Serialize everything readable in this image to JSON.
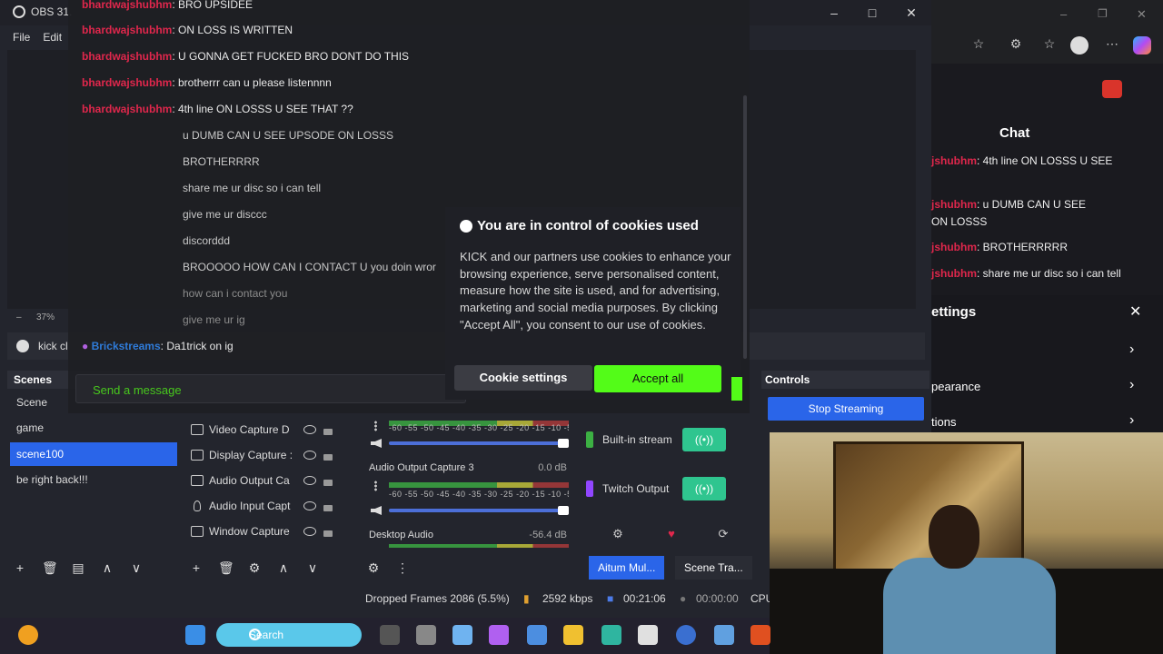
{
  "obs": {
    "title": "OBS 31.",
    "menu": [
      "File",
      "Edit"
    ],
    "zoom": "37%",
    "dock_tab": "kick cl",
    "scenes_header": "Scenes",
    "scenes": [
      "Scene",
      "game",
      "scene100",
      "be right back!!!"
    ],
    "active_scene_index": 2,
    "sources": [
      {
        "label": "Video Capture D",
        "icon": "camera-icon"
      },
      {
        "label": "Display Capture :",
        "icon": "monitor-icon"
      },
      {
        "label": "Audio Output Ca",
        "icon": "speaker-icon"
      },
      {
        "label": "Audio Input Capt",
        "icon": "microphone-icon"
      },
      {
        "label": "Window Capture",
        "icon": "window-icon"
      }
    ],
    "mixer": {
      "scale": "-60 -55 -50 -45 -40 -35 -30 -25 -20 -15 -10 -5 0",
      "channels": [
        {
          "label": "",
          "db": ""
        },
        {
          "label": "Audio Output Capture 3",
          "db": "0.0 dB"
        },
        {
          "label": "Desktop Audio",
          "db": "-56.4 dB"
        }
      ]
    },
    "outputs": [
      {
        "label": "Built-in stream",
        "marker_color": "#3cb043"
      },
      {
        "label": "Twitch Output",
        "marker_color": "#9146ff"
      }
    ],
    "controls_header": "Controls",
    "stop_streaming": "Stop Streaming",
    "bottom_tabs": [
      "Aitum Mul...",
      "Scene Tra..."
    ],
    "status": {
      "dropped_frames": "Dropped Frames 2086 (5.5%)",
      "bitrate": "2592 kbps",
      "stream_time": "00:21:06",
      "record_time": "00:00:00",
      "cpu": "CPU"
    }
  },
  "chat_overlay": {
    "messages": [
      {
        "user": "bhardwajshubhm",
        "text": ": BRO UPSIDEE",
        "style": "red"
      },
      {
        "user": "bhardwajshubhm",
        "text": ": ON LOSS IS WRITTEN",
        "style": "red"
      },
      {
        "user": "bhardwajshubhm",
        "text": ": U GONNA GET FUCKED BRO DONT DO THIS",
        "style": "red"
      },
      {
        "user": "bhardwajshubhm",
        "text": ": brotherrr can u please listennnn",
        "style": "red"
      },
      {
        "user": "bhardwajshubhm",
        "text": ": 4th line ON LOSSS U SEE THAT ??",
        "style": "red"
      },
      {
        "user": "",
        "text": "u DUMB CAN U SEE UPSODE ON LOSSS",
        "style": "dim"
      },
      {
        "user": "",
        "text": "BROTHERRRR",
        "style": "dim"
      },
      {
        "user": "",
        "text": "share me ur disc so i can tell",
        "style": "dim"
      },
      {
        "user": "",
        "text": "give me ur disccc",
        "style": "dim"
      },
      {
        "user": "",
        "text": "discorddd",
        "style": "dim"
      },
      {
        "user": "",
        "text": "BROOOOO HOW CAN I CONTACT U you doin wror",
        "style": "dim"
      },
      {
        "user": "",
        "text": "how can i contact you",
        "style": "dim"
      },
      {
        "user": "",
        "text": "give me ur ig",
        "style": "dim"
      },
      {
        "user": "Brickstreams",
        "text": ": Da1trick on ig",
        "style": "blue"
      }
    ],
    "input_placeholder": "Send a message"
  },
  "cookie": {
    "title": "You are in control of cookies used",
    "body": "KICK and our partners use cookies to enhance your browsing experience, serve personalised content, measure how the site is used, and for advertising, marketing and social media purposes. By clicking \"Accept All\", you consent to our use of cookies.",
    "settings_button": "Cookie settings",
    "accept_button": "Accept all"
  },
  "browser": {
    "chat_title": "Chat",
    "messages": [
      {
        "user": "jshubhm",
        "text": ": 4th line ON LOSSS U SEE"
      },
      {
        "user": "jshubhm",
        "text": ": u DUMB CAN U SEE"
      },
      {
        "user": "",
        "text": "ON LOSSS"
      },
      {
        "user": "jshubhm",
        "text": ": BROTHERRRRR"
      },
      {
        "user": "jshubhm",
        "text": ": share me ur disc so i can tell"
      }
    ],
    "settings_title": "ettings",
    "settings_items": [
      "",
      "pearance",
      "tions"
    ]
  },
  "taskbar": {
    "search_label": "Search"
  }
}
